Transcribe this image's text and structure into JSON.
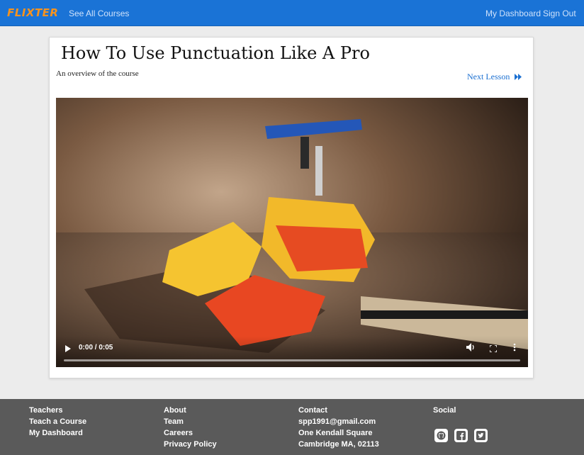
{
  "nav": {
    "brand": "FLIXTER",
    "see_all_courses": "See All Courses",
    "my_dashboard": "My Dashboard",
    "sign_out": "Sign Out"
  },
  "lesson": {
    "title": "How To Use Punctuation Like A Pro",
    "subtitle": "An overview of the course",
    "next_lesson": "Next Lesson"
  },
  "video": {
    "time": "0:00 / 0:05",
    "progress": 0
  },
  "footer": {
    "teachers": {
      "heading": "Teachers",
      "items": [
        "Teach a Course",
        "My Dashboard"
      ]
    },
    "about": {
      "heading": "About",
      "items": [
        "Team",
        "Careers",
        "Privacy Policy"
      ]
    },
    "contact": {
      "heading": "Contact",
      "items": [
        "spp1991@gmail.com",
        "One Kendall Square",
        "Cambridge MA, 02113"
      ]
    },
    "social": {
      "heading": "Social",
      "icons": [
        "github-icon",
        "facebook-icon",
        "twitter-icon"
      ]
    }
  },
  "colors": {
    "navbar": "#1a73d6",
    "brand": "#f7931e",
    "link": "#1a6fd1",
    "footer": "#5a5a5a"
  }
}
